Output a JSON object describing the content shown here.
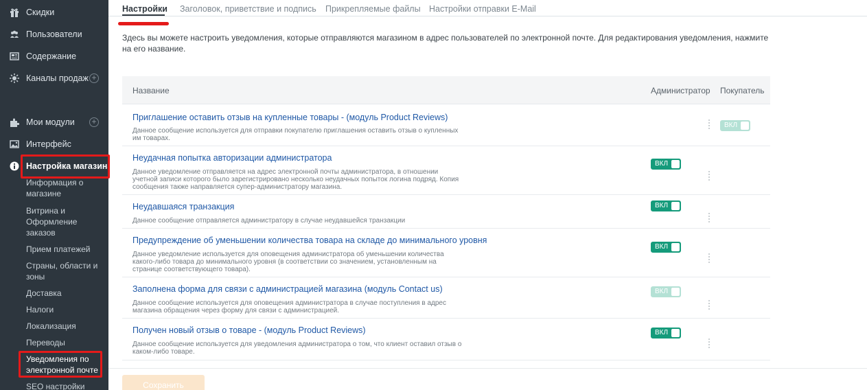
{
  "sidebar": {
    "items": [
      {
        "label": "Скидки",
        "icon": "gift-icon"
      },
      {
        "label": "Пользователи",
        "icon": "users-icon"
      },
      {
        "label": "Содержание",
        "icon": "newspaper-icon"
      },
      {
        "label": "Каналы продаж",
        "icon": "sun-icon"
      },
      {
        "label": "Мои модули",
        "icon": "puzzle-icon"
      },
      {
        "label": "Интерфейс",
        "icon": "image-icon"
      },
      {
        "label": "Настройка магазина",
        "icon": "info-icon"
      }
    ],
    "plus_symbol": "+",
    "sub_items": [
      "Информация о магазине",
      "Витрина и Оформление заказов",
      "Прием платежей",
      "Страны, области и зоны",
      "Доставка",
      "Налоги",
      "Локализация",
      "Переводы",
      "Уведомления по электронной почте",
      "SEO настройки"
    ]
  },
  "tabs": [
    {
      "label": "Настройки"
    },
    {
      "label": "Заголовок, приветствие и подпись"
    },
    {
      "label": "Прикрепляемые файлы"
    },
    {
      "label": "Настройки отправки E-Mail"
    }
  ],
  "intro_text": "Здесь вы можете настроить уведомления, которые отправляются магазином в адрес пользователей по электронной почте. Для редактирования уведомления, нажмите на его название.",
  "table": {
    "headers": {
      "name": "Название",
      "admin": "Администратор",
      "customer": "Покупатель"
    },
    "toggle_label": "ВКЛ",
    "rows": [
      {
        "title": "Приглашение оставить отзыв на купленные товары - (модуль Product Reviews)",
        "description": "Данное сообщение используется для отправки покупателю приглашения оставить отзыв о купленных им товарах."
      },
      {
        "title": "Неудачная попытка авторизации администратора",
        "description": "Данное уведомление отправляется на адрес электронной почты администратора, в отношении учетной записи которого было зарегистрировано несколько неудачных попыток логина подряд. Копия сообщения также направляется супер-администратору магазина."
      },
      {
        "title": "Неудавшаяся транзакция",
        "description": "Данное сообщение отправляется администратору в случае неудавшейся транзакции"
      },
      {
        "title": "Предупреждение об уменьшении количества товара на складе до минимального уровня",
        "description": "Данное уведомление используется для оповещения администратора об уменьшении количества какого-либо товара до минимального уровня (в соответствии со значением, установленным на странице соответствующего товара)."
      },
      {
        "title": "Заполнена форма для связи с администрацией магазина (модуль Contact us)",
        "description": "Данное сообщение используется для оповещения администратора в случае поступления в адрес магазина обращения через форму для связи с администрацией."
      },
      {
        "title": "Получен новый отзыв о товаре - (модуль Product Reviews)",
        "description": "Данное сообщение используется для уведомления администратора о том, что клиент оставил отзыв о каком-либо товаре."
      }
    ]
  },
  "save_button": "Сохранить",
  "colors": {
    "sidebar_bg": "#2d363e",
    "toggle_on": "#159b7b",
    "highlight": "#e41a1a",
    "link": "#1f58a6"
  }
}
